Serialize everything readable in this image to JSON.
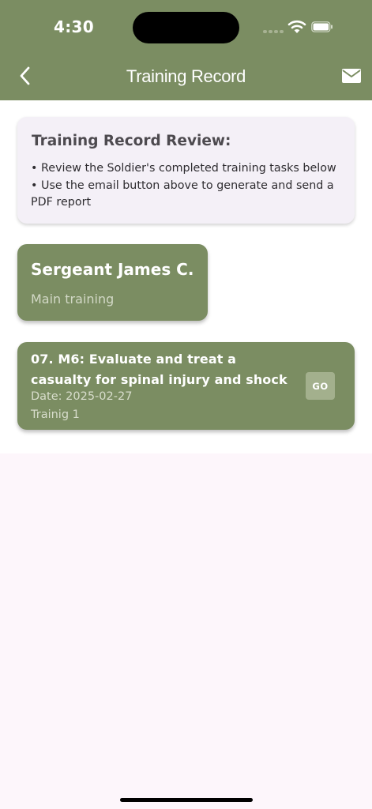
{
  "status_bar": {
    "time": "4:30"
  },
  "app_bar": {
    "title": "Training Record",
    "back_icon": "chevron-left-icon",
    "action_icon": "mail-icon"
  },
  "review": {
    "title": "Training Record Review:",
    "instructions": "• Review the Soldier's completed training tasks below\n• Use the email button above to generate and send a PDF report"
  },
  "soldier": {
    "name": "Sergeant James C.",
    "subtitle": "Main training"
  },
  "tasks": [
    {
      "title": "07. M6: Evaluate and treat a casualty for spinal injury and shock",
      "date": "Date: 2025-02-27",
      "subtitle": "Trainig 1",
      "button_label": "GO"
    }
  ],
  "colors": {
    "accent": "#7b8d62",
    "card_background": "#f4f0f7",
    "page_background": "#fdf6fb"
  }
}
